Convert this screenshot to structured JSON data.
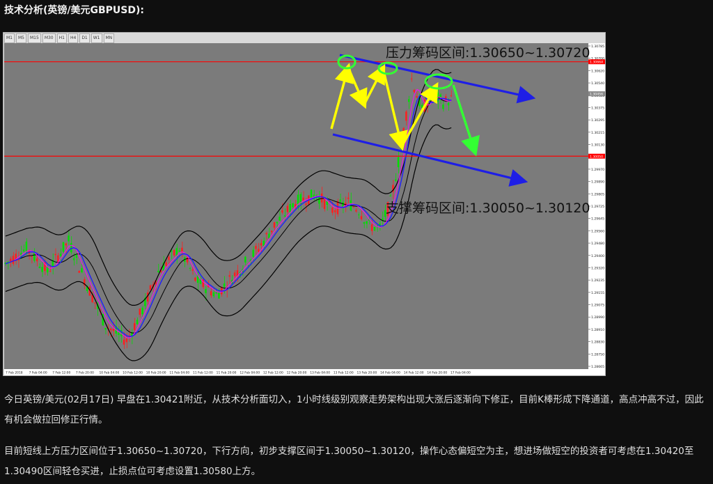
{
  "page": {
    "heading": "技术分析(英镑/美元GBPUSD):",
    "paragraphs": [
      "今日英镑/美元(02月17日) 早盘在1.30421附近，从技术分析面切入，1小时线级别观察走势架构出现大涨后逐渐向下修正，目前K棒形成下降通道，高点冲高不过，因此有机会做拉回修正行情。",
      "目前短线上方压力区间位于1.30650~1.30720，下行方向，初步支撑区间于1.30050~1.30120，操作心态偏短空为主，想进场做短空的投资者可考虑在1.30420至1.30490区间轻仓买进，止损点位可考虑设置1.30580上方。"
    ]
  },
  "toolbar": {
    "timeframes": [
      "M1",
      "M5",
      "M15",
      "M30",
      "H1",
      "H4",
      "D1",
      "W1",
      "MN"
    ]
  },
  "chart_data": {
    "type": "candlestick",
    "symbol": "GBPUSD",
    "timeframe": "H1",
    "ylim": [
      1.28665,
      1.30785
    ],
    "y_ticks": [
      "1.30785",
      "1.30700",
      "1.30620",
      "1.30540",
      "1.30456",
      "1.30375",
      "1.30295",
      "1.30215",
      "1.30130",
      "1.30050",
      "1.29970",
      "1.29890",
      "1.29805",
      "1.29725",
      "1.29645",
      "1.29560",
      "1.29480",
      "1.29400",
      "1.29320",
      "1.29235",
      "1.29155",
      "1.29075",
      "1.28990",
      "1.28910",
      "1.28830",
      "1.28750",
      "1.28665"
    ],
    "x_ticks": [
      "7 Feb 2018",
      "7 Feb 04:00",
      "7 Feb 12:00",
      "7 Feb 20:00",
      "10 Feb 04:00",
      "10 Feb 12:00",
      "10 Feb 20:00",
      "11 Feb 04:00",
      "11 Feb 12:00",
      "11 Feb 20:00",
      "12 Feb 04:00",
      "12 Feb 12:00",
      "12 Feb 20:00",
      "13 Feb 04:00",
      "13 Feb 12:00",
      "13 Feb 20:00",
      "14 Feb 04:00",
      "14 Feb 12:00",
      "14 Feb 20:00",
      "17 Feb 04:00"
    ],
    "price_tags": {
      "current": "1.30456",
      "resistance_line": "1.30664",
      "support_line": "1.30050"
    },
    "horizontal_lines": [
      1.30664,
      1.3005
    ],
    "annotations": {
      "resistance_text": "压力筹码区间:1.30650~1.30720",
      "support_text": "支撑筹码区间:1.30050~1.30120"
    },
    "colors": {
      "bull": "#00e000",
      "bear": "#ff1e1e",
      "ma_fast": "#1e1eff",
      "ma_slow": "#ff00ff",
      "bands": "#000000",
      "level_line": "#ff0000",
      "channel": "#1e1ee6",
      "zigzag": "#ffff00",
      "circle": "#33ff33",
      "plot_bg": "#7b7b7b"
    }
  }
}
